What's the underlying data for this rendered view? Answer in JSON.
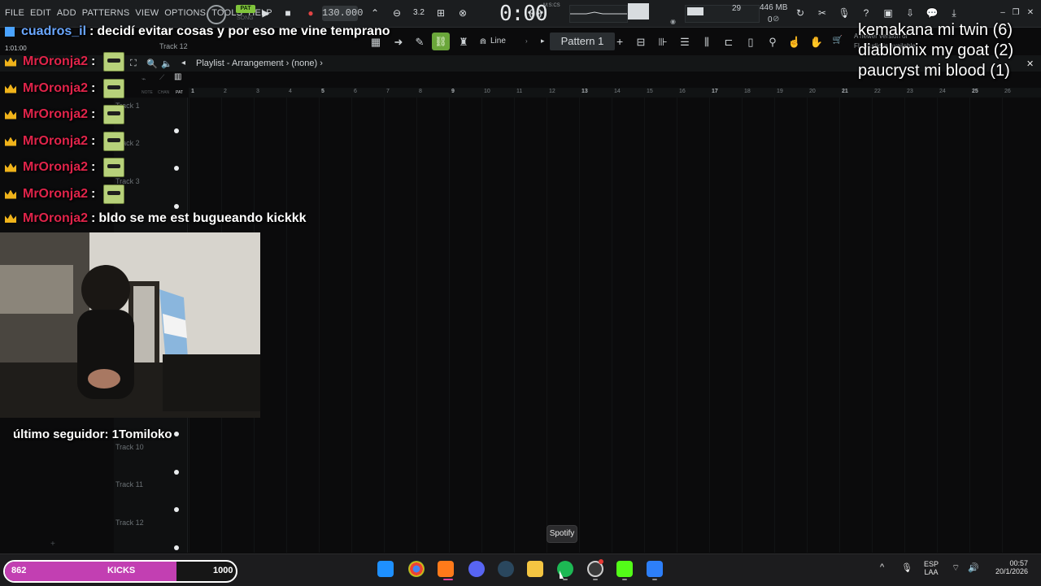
{
  "menu": [
    "FILE",
    "EDIT",
    "ADD",
    "PATTERNS",
    "VIEW",
    "OPTIONS",
    "TOOLS",
    "HELP"
  ],
  "transport": {
    "pat_label": "PAT",
    "song_label": "SONG",
    "tempo": "130.000",
    "time": "0:00",
    "time_ms": "00",
    "time_unit": "M:S:CS",
    "cpu": "29",
    "ram": "446 MB",
    "polyphony": "0"
  },
  "toolbar": {
    "snap_label": "Line",
    "pattern_label": "Pattern 1",
    "pattern_add": "+"
  },
  "playlist": {
    "title": "Playlist - Arrangement",
    "breadcrumb": "(none)",
    "hint": "1:01:00",
    "track_header": "Track 12",
    "ruler": [
      "1",
      "2",
      "3",
      "4",
      "5",
      "6",
      "7",
      "8",
      "9",
      "10",
      "11",
      "12",
      "13",
      "14",
      "15",
      "16",
      "17",
      "18",
      "19",
      "20",
      "21",
      "22",
      "23",
      "24",
      "25",
      "26"
    ],
    "tracks": [
      {
        "label": "Track 1"
      },
      {
        "label": "Track 2"
      },
      {
        "label": "Track 3"
      },
      {
        "label": "Track 10"
      },
      {
        "label": "Track 11"
      },
      {
        "label": "Track 12"
      }
    ],
    "col_labels": [
      "NOTE",
      "CHAN",
      "PAT"
    ]
  },
  "chat": [
    {
      "user": "cuadros_il",
      "text": "decidí evitar cosas y por eso me vine temprano",
      "emote": false
    },
    {
      "user": "MrOronja2",
      "text": "",
      "emote": true
    },
    {
      "user": "MrOronja2",
      "text": "",
      "emote": true
    },
    {
      "user": "MrOronja2",
      "text": "",
      "emote": true
    },
    {
      "user": "MrOronja2",
      "text": "",
      "emote": true
    },
    {
      "user": "MrOronja2",
      "text": "",
      "emote": true
    },
    {
      "user": "MrOronja2",
      "text": "",
      "emote": true
    },
    {
      "user": "MrOronja2",
      "text": "bldo se me est bugueando kickkk",
      "emote": false
    }
  ],
  "overlay": {
    "lines": [
      "kemakana mi twin (6)",
      "diablomix my goat (2)",
      "paucryst mi blood (1)"
    ],
    "notice": "A newer version of",
    "notice2": "FL Studio is available"
  },
  "follower": "último seguidor: 1Tomiloko",
  "kicks": {
    "current": "862",
    "label": "KICKS",
    "goal": "1000",
    "progress": 0.862
  },
  "taskbar": {
    "tooltip": "Spotify",
    "lang": "ESP",
    "lang_sub": "LAA",
    "time": "00:57",
    "date": "20/1/2026",
    "apps": [
      "windows-start",
      "chrome",
      "fl-studio",
      "discord",
      "steam",
      "file-explorer",
      "spotify",
      "obs",
      "kick",
      "roblox"
    ]
  },
  "colors": {
    "accent": "#7fc33b",
    "chat_user": "#e0244a",
    "kicks_fill": "#c23fb2"
  }
}
